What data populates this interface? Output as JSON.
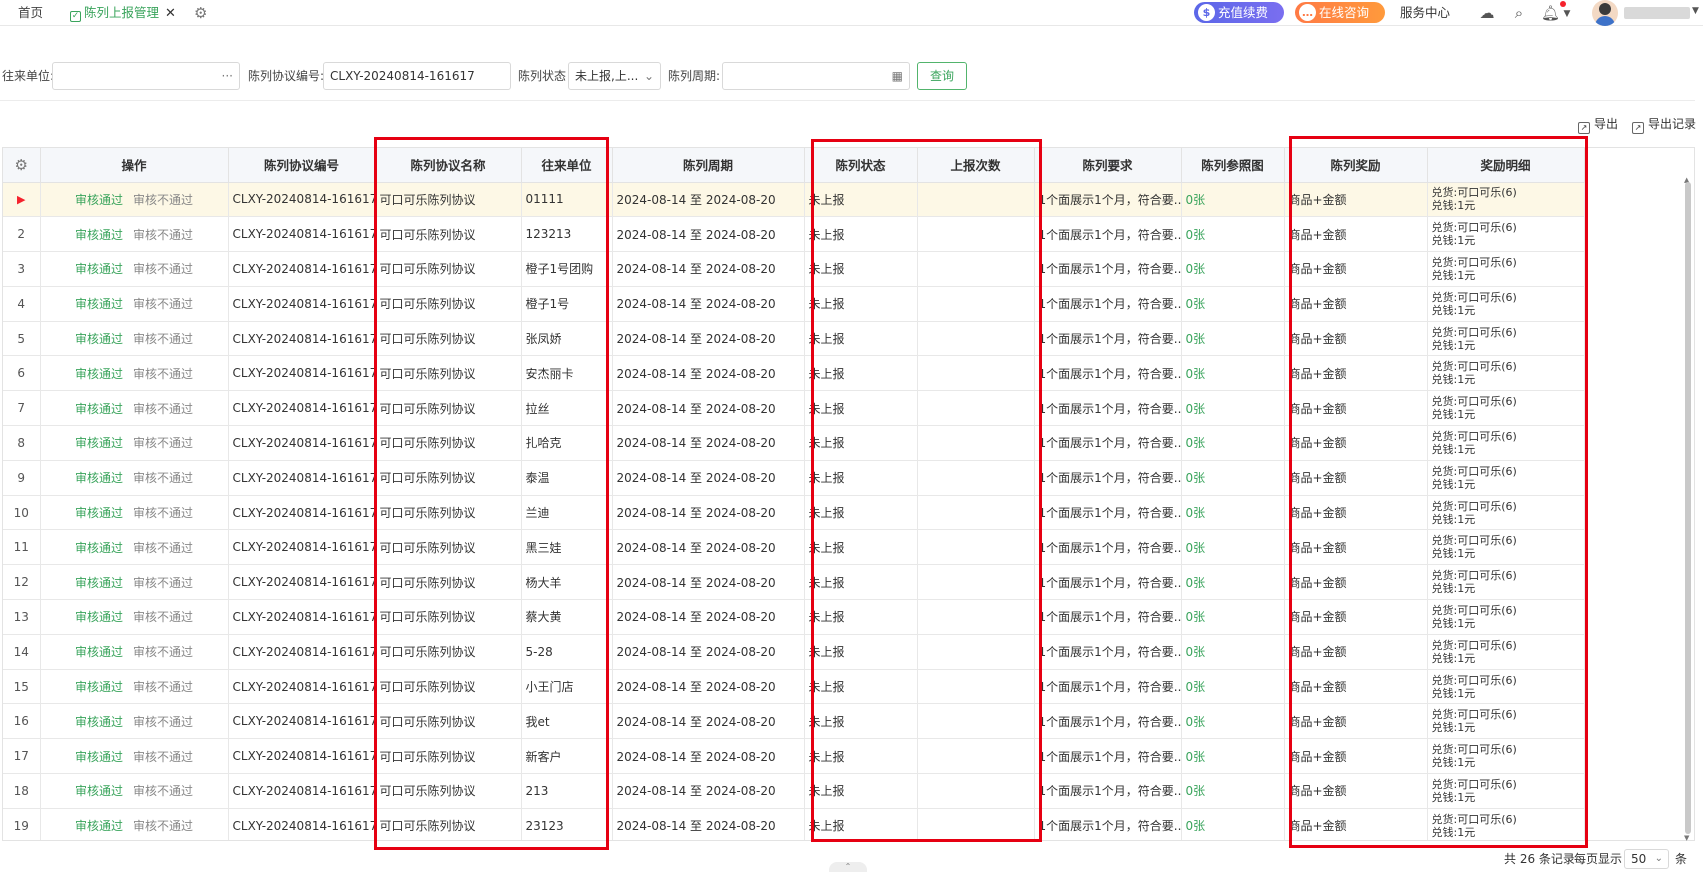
{
  "tabs": {
    "home": "首页",
    "active": "陈列上报管理",
    "close": "✕"
  },
  "header": {
    "recharge": "充值续费",
    "consult": "在线咨询",
    "service_center": "服务中心"
  },
  "filter": {
    "partner_label": "往来单位:",
    "partner_value": "",
    "partner_suffix": "···",
    "protocol_no_label": "陈列协议编号:",
    "protocol_no_value": "CLXY-20240814-161617",
    "status_label": "陈列状态",
    "status_value": "未上报,上...",
    "period_label": "陈列周期:",
    "period_value": "",
    "query_button": "查询"
  },
  "toolbar": {
    "export": "导出",
    "export_records": "导出记录"
  },
  "table": {
    "columns": [
      "操作",
      "陈列协议编号",
      "陈列协议名称",
      "往来单位",
      "陈列周期",
      "陈列状态",
      "上报次数",
      "陈列要求",
      "陈列参照图",
      "陈列奖励",
      "奖励明细"
    ],
    "op_pass": "审核通过",
    "op_fail": "审核不通过",
    "rows": [
      {
        "idx": "",
        "protocol_no": "CLXY-20240814-161617",
        "name": "可口可乐陈列协议",
        "partner": "01111",
        "period": "2024-08-14 至 2024-08-20",
        "status": "未上报",
        "reports": "",
        "requirement": "1个面展示1个月，符合要...",
        "ref": "0张",
        "reward": "商品+金额",
        "detail1": "兑货:可口可乐(6)",
        "detail2": "兑钱:1元"
      },
      {
        "idx": "2",
        "protocol_no": "CLXY-20240814-161617",
        "name": "可口可乐陈列协议",
        "partner": "123213",
        "period": "2024-08-14 至 2024-08-20",
        "status": "未上报",
        "reports": "",
        "requirement": "1个面展示1个月，符合要...",
        "ref": "0张",
        "reward": "商品+金额",
        "detail1": "兑货:可口可乐(6)",
        "detail2": "兑钱:1元"
      },
      {
        "idx": "3",
        "protocol_no": "CLXY-20240814-161617",
        "name": "可口可乐陈列协议",
        "partner": "橙子1号团购",
        "period": "2024-08-14 至 2024-08-20",
        "status": "未上报",
        "reports": "",
        "requirement": "1个面展示1个月，符合要...",
        "ref": "0张",
        "reward": "商品+金额",
        "detail1": "兑货:可口可乐(6)",
        "detail2": "兑钱:1元"
      },
      {
        "idx": "4",
        "protocol_no": "CLXY-20240814-161617",
        "name": "可口可乐陈列协议",
        "partner": "橙子1号",
        "period": "2024-08-14 至 2024-08-20",
        "status": "未上报",
        "reports": "",
        "requirement": "1个面展示1个月，符合要...",
        "ref": "0张",
        "reward": "商品+金额",
        "detail1": "兑货:可口可乐(6)",
        "detail2": "兑钱:1元"
      },
      {
        "idx": "5",
        "protocol_no": "CLXY-20240814-161617",
        "name": "可口可乐陈列协议",
        "partner": "张凤娇",
        "period": "2024-08-14 至 2024-08-20",
        "status": "未上报",
        "reports": "",
        "requirement": "1个面展示1个月，符合要...",
        "ref": "0张",
        "reward": "商品+金额",
        "detail1": "兑货:可口可乐(6)",
        "detail2": "兑钱:1元"
      },
      {
        "idx": "6",
        "protocol_no": "CLXY-20240814-161617",
        "name": "可口可乐陈列协议",
        "partner": "安杰丽卡",
        "period": "2024-08-14 至 2024-08-20",
        "status": "未上报",
        "reports": "",
        "requirement": "1个面展示1个月，符合要...",
        "ref": "0张",
        "reward": "商品+金额",
        "detail1": "兑货:可口可乐(6)",
        "detail2": "兑钱:1元"
      },
      {
        "idx": "7",
        "protocol_no": "CLXY-20240814-161617",
        "name": "可口可乐陈列协议",
        "partner": "拉丝",
        "period": "2024-08-14 至 2024-08-20",
        "status": "未上报",
        "reports": "",
        "requirement": "1个面展示1个月，符合要...",
        "ref": "0张",
        "reward": "商品+金额",
        "detail1": "兑货:可口可乐(6)",
        "detail2": "兑钱:1元"
      },
      {
        "idx": "8",
        "protocol_no": "CLXY-20240814-161617",
        "name": "可口可乐陈列协议",
        "partner": "扎哈克",
        "period": "2024-08-14 至 2024-08-20",
        "status": "未上报",
        "reports": "",
        "requirement": "1个面展示1个月，符合要...",
        "ref": "0张",
        "reward": "商品+金额",
        "detail1": "兑货:可口可乐(6)",
        "detail2": "兑钱:1元"
      },
      {
        "idx": "9",
        "protocol_no": "CLXY-20240814-161617",
        "name": "可口可乐陈列协议",
        "partner": "泰温",
        "period": "2024-08-14 至 2024-08-20",
        "status": "未上报",
        "reports": "",
        "requirement": "1个面展示1个月，符合要...",
        "ref": "0张",
        "reward": "商品+金额",
        "detail1": "兑货:可口可乐(6)",
        "detail2": "兑钱:1元"
      },
      {
        "idx": "10",
        "protocol_no": "CLXY-20240814-161617",
        "name": "可口可乐陈列协议",
        "partner": "兰迪",
        "period": "2024-08-14 至 2024-08-20",
        "status": "未上报",
        "reports": "",
        "requirement": "1个面展示1个月，符合要...",
        "ref": "0张",
        "reward": "商品+金额",
        "detail1": "兑货:可口可乐(6)",
        "detail2": "兑钱:1元"
      },
      {
        "idx": "11",
        "protocol_no": "CLXY-20240814-161617",
        "name": "可口可乐陈列协议",
        "partner": "黑三娃",
        "period": "2024-08-14 至 2024-08-20",
        "status": "未上报",
        "reports": "",
        "requirement": "1个面展示1个月，符合要...",
        "ref": "0张",
        "reward": "商品+金额",
        "detail1": "兑货:可口可乐(6)",
        "detail2": "兑钱:1元"
      },
      {
        "idx": "12",
        "protocol_no": "CLXY-20240814-161617",
        "name": "可口可乐陈列协议",
        "partner": "杨大羊",
        "period": "2024-08-14 至 2024-08-20",
        "status": "未上报",
        "reports": "",
        "requirement": "1个面展示1个月，符合要...",
        "ref": "0张",
        "reward": "商品+金额",
        "detail1": "兑货:可口可乐(6)",
        "detail2": "兑钱:1元"
      },
      {
        "idx": "13",
        "protocol_no": "CLXY-20240814-161617",
        "name": "可口可乐陈列协议",
        "partner": "蔡大黄",
        "period": "2024-08-14 至 2024-08-20",
        "status": "未上报",
        "reports": "",
        "requirement": "1个面展示1个月，符合要...",
        "ref": "0张",
        "reward": "商品+金额",
        "detail1": "兑货:可口可乐(6)",
        "detail2": "兑钱:1元"
      },
      {
        "idx": "14",
        "protocol_no": "CLXY-20240814-161617",
        "name": "可口可乐陈列协议",
        "partner": "5-28",
        "period": "2024-08-14 至 2024-08-20",
        "status": "未上报",
        "reports": "",
        "requirement": "1个面展示1个月，符合要...",
        "ref": "0张",
        "reward": "商品+金额",
        "detail1": "兑货:可口可乐(6)",
        "detail2": "兑钱:1元"
      },
      {
        "idx": "15",
        "protocol_no": "CLXY-20240814-161617",
        "name": "可口可乐陈列协议",
        "partner": "小王门店",
        "period": "2024-08-14 至 2024-08-20",
        "status": "未上报",
        "reports": "",
        "requirement": "1个面展示1个月，符合要...",
        "ref": "0张",
        "reward": "商品+金额",
        "detail1": "兑货:可口可乐(6)",
        "detail2": "兑钱:1元"
      },
      {
        "idx": "16",
        "protocol_no": "CLXY-20240814-161617",
        "name": "可口可乐陈列协议",
        "partner": "我et",
        "period": "2024-08-14 至 2024-08-20",
        "status": "未上报",
        "reports": "",
        "requirement": "1个面展示1个月，符合要...",
        "ref": "0张",
        "reward": "商品+金额",
        "detail1": "兑货:可口可乐(6)",
        "detail2": "兑钱:1元"
      },
      {
        "idx": "17",
        "protocol_no": "CLXY-20240814-161617",
        "name": "可口可乐陈列协议",
        "partner": "新客户",
        "period": "2024-08-14 至 2024-08-20",
        "status": "未上报",
        "reports": "",
        "requirement": "1个面展示1个月，符合要...",
        "ref": "0张",
        "reward": "商品+金额",
        "detail1": "兑货:可口可乐(6)",
        "detail2": "兑钱:1元"
      },
      {
        "idx": "18",
        "protocol_no": "CLXY-20240814-161617",
        "name": "可口可乐陈列协议",
        "partner": "213",
        "period": "2024-08-14 至 2024-08-20",
        "status": "未上报",
        "reports": "",
        "requirement": "1个面展示1个月，符合要...",
        "ref": "0张",
        "reward": "商品+金额",
        "detail1": "兑货:可口可乐(6)",
        "detail2": "兑钱:1元"
      },
      {
        "idx": "19",
        "protocol_no": "CLXY-20240814-161617",
        "name": "可口可乐陈列协议",
        "partner": "23123",
        "period": "2024-08-14 至 2024-08-20",
        "status": "未上报",
        "reports": "",
        "requirement": "1个面展示1个月，符合要...",
        "ref": "0张",
        "reward": "商品+金额",
        "detail1": "兑货:可口可乐(6)",
        "detail2": "兑钱:1元"
      }
    ]
  },
  "footer": {
    "total": "共 26 条记录",
    "per_page_label": "每页显示",
    "per_page_value": "50",
    "unit": "条"
  },
  "colors": {
    "accent_green": "#3aa45c",
    "highlight_red": "#e60012",
    "selected_row": "#fdf8e6"
  }
}
